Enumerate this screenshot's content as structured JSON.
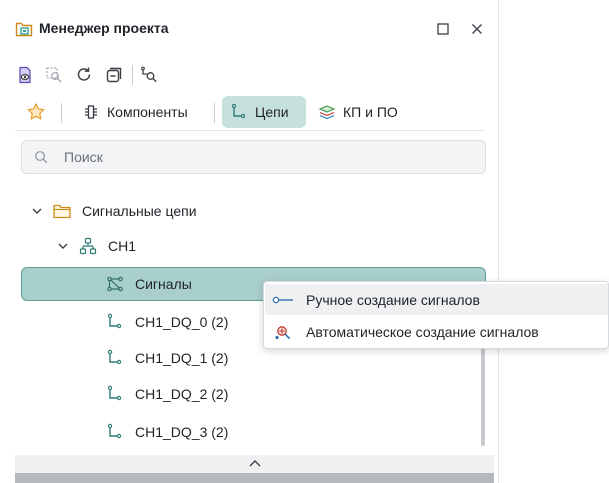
{
  "panel": {
    "title": "Менеджер проекта",
    "title_icon": "project-folder-icon",
    "window_buttons": {
      "maximize": "maximize-icon",
      "close": "close-icon"
    }
  },
  "toolbar": {
    "icons": [
      "eye-document-icon",
      "zoom-fit-icon",
      "refresh-icon",
      "collapse-all-icon",
      "find-net-icon"
    ]
  },
  "tabs": [
    {
      "label": "Компоненты",
      "icon": "component-icon",
      "active": false
    },
    {
      "label": "Цепи",
      "icon": "net-icon",
      "active": true
    },
    {
      "label": "КП и ПО",
      "icon": "pad-icon",
      "active": false
    }
  ],
  "favorites_icon": "star-icon",
  "search": {
    "placeholder": "Поиск",
    "value": ""
  },
  "tree": {
    "root": {
      "label": "Сигнальные цепи",
      "icon": "folder-icon",
      "expanded": true
    },
    "group": {
      "label": "CH1",
      "icon": "net-group-icon",
      "expanded": true
    },
    "signals": {
      "label": "Сигналы",
      "icon": "signals-icon",
      "selected": true
    },
    "nets": [
      {
        "label": "CH1_DQ_0 (2)",
        "icon": "net-icon"
      },
      {
        "label": "CH1_DQ_1 (2)",
        "icon": "net-icon"
      },
      {
        "label": "CH1_DQ_2 (2)",
        "icon": "net-icon"
      },
      {
        "label": "CH1_DQ_3 (2)",
        "icon": "net-icon"
      }
    ]
  },
  "context_menu": {
    "items": [
      {
        "label": "Ручное создание сигналов",
        "icon": "signal-line-icon",
        "hovered": true
      },
      {
        "label": "Автоматическое создание сигналов",
        "icon": "auto-signal-icon",
        "hovered": false
      }
    ]
  },
  "colors": {
    "accent": "#2f9c8f",
    "selection": "#a9cfcc",
    "selection_border": "#5e9f9a",
    "tab_active": "#c6e0dd",
    "star": "#e8a33a"
  }
}
